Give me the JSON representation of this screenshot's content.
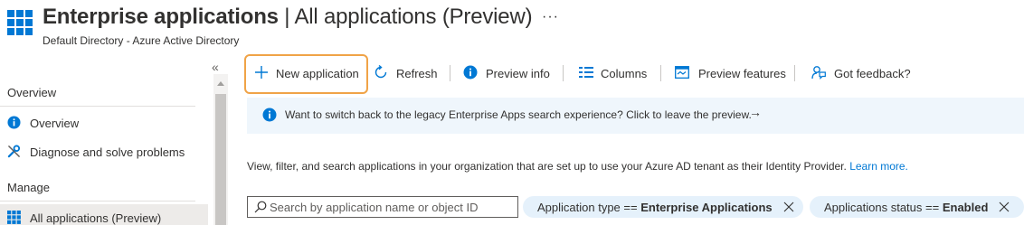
{
  "header": {
    "title_bold": "Enterprise applications",
    "title_separator": " | ",
    "title_rest": "All applications (Preview)",
    "subtitle": "Default Directory - Azure Active Directory",
    "more_label": "···"
  },
  "sidebar": {
    "collapse_label": "«",
    "overview_section": "Overview",
    "items": [
      {
        "label": "Overview",
        "icon": "info-icon"
      },
      {
        "label": "Diagnose and solve problems",
        "icon": "wrench-icon"
      }
    ],
    "manage_section": "Manage",
    "manage_items": [
      {
        "label": "All applications (Preview)",
        "icon": "grid-icon",
        "selected": true
      }
    ]
  },
  "toolbar": {
    "new_application": "New application",
    "refresh": "Refresh",
    "preview_info": "Preview info",
    "columns": "Columns",
    "preview_features": "Preview features",
    "got_feedback": "Got feedback?"
  },
  "banner": {
    "text": "Want to switch back to the legacy Enterprise Apps search experience? Click to leave the preview.",
    "arrow": "→"
  },
  "description": {
    "text": "View, filter, and search applications in your organization that are set up to use your Azure AD tenant as their Identity Provider.",
    "link": "Learn more."
  },
  "filters": {
    "search_placeholder": "Search by application name or object ID",
    "search_value": "",
    "pills": [
      {
        "key": "Application type",
        "op": " == ",
        "value": "Enterprise Applications"
      },
      {
        "key": "Applications status",
        "op": " == ",
        "value": "Enabled"
      }
    ]
  },
  "colors": {
    "accent": "#0078d4",
    "highlight_border": "#f0a347",
    "banner_bg": "#eff6fc",
    "pill_bg": "#e5f1fb"
  }
}
